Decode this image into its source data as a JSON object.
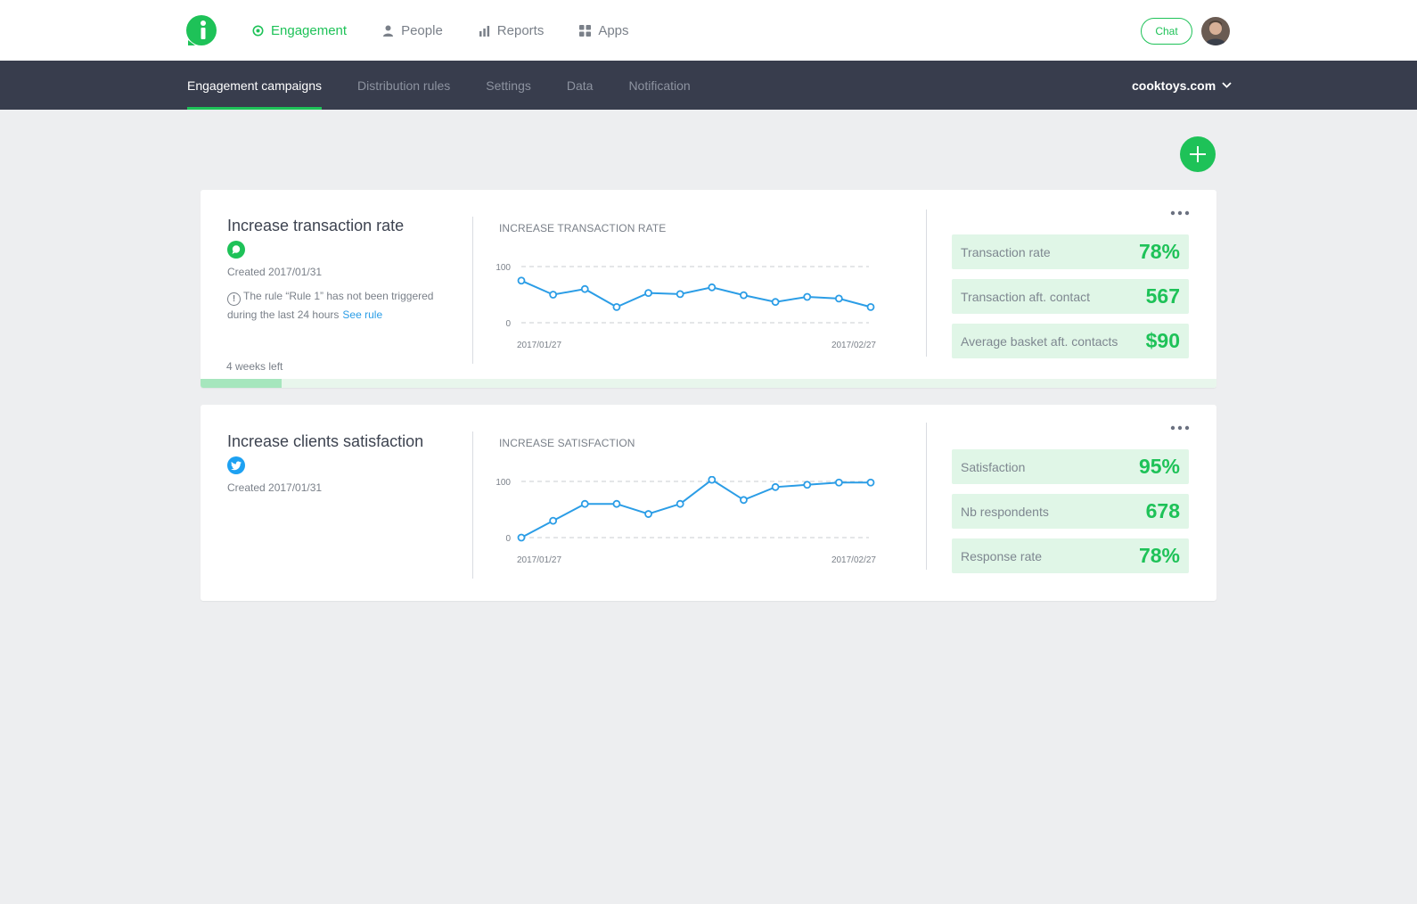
{
  "nav": {
    "items": [
      {
        "label": "Engagement",
        "icon": "target-icon",
        "active": true
      },
      {
        "label": "People",
        "icon": "person-icon",
        "active": false
      },
      {
        "label": "Reports",
        "icon": "bar-chart-icon",
        "active": false
      },
      {
        "label": "Apps",
        "icon": "grid-icon",
        "active": false
      }
    ],
    "chat_label": "Chat"
  },
  "subnav": {
    "tabs": [
      {
        "label": "Engagement campaigns",
        "active": true
      },
      {
        "label": "Distribution rules",
        "active": false
      },
      {
        "label": "Settings",
        "active": false
      },
      {
        "label": "Data",
        "active": false
      },
      {
        "label": "Notification",
        "active": false
      }
    ],
    "site": "cooktoys.com"
  },
  "colors": {
    "accent": "#1ec258",
    "chart_line": "#2b9de6",
    "twitter": "#1da1f2",
    "subnav_bg": "#383d4d"
  },
  "campaigns": [
    {
      "title": "Increase transaction rate",
      "channel_icon": "chat-bubble-icon",
      "created": "Created 2017/01/31",
      "warning_text": "The rule “Rule 1” has not been triggered during the last 24 hours",
      "warning_link": "See rule",
      "weeks_left": "4 weeks left",
      "progress": 0.08,
      "chart_title": "INCREASE TRANSACTION RATE",
      "stats": [
        {
          "label": "Transaction rate",
          "value": "78%"
        },
        {
          "label": "Transaction aft. contact",
          "value": "567"
        },
        {
          "label": "Average basket aft. contacts",
          "value": "$90"
        }
      ]
    },
    {
      "title": "Increase clients satisfaction",
      "channel_icon": "twitter-icon",
      "created": "Created 2017/01/31",
      "chart_title": "INCREASE SATISFACTION",
      "stats": [
        {
          "label": "Satisfaction",
          "value": "95%"
        },
        {
          "label": "Nb respondents",
          "value": "678"
        },
        {
          "label": "Response rate",
          "value": "78%"
        }
      ]
    }
  ],
  "chart_data": [
    {
      "type": "line",
      "title": "INCREASE TRANSACTION RATE",
      "x": [
        "2017/01/27",
        "",
        "",
        "",
        "",
        "",
        "",
        "",
        "",
        "",
        "",
        "2017/02/27"
      ],
      "x_tick_labels": [
        "2017/01/27",
        "2017/02/27"
      ],
      "y_tick_labels": [
        "100",
        "0"
      ],
      "ylim": [
        0,
        100
      ],
      "grid": true,
      "series": [
        {
          "values": [
            75,
            50,
            60,
            28,
            53,
            51,
            63,
            49,
            37,
            46,
            43,
            28
          ]
        }
      ]
    },
    {
      "type": "line",
      "title": "INCREASE SATISFACTION",
      "x": [
        "2017/01/27",
        "",
        "",
        "",
        "",
        "",
        "",
        "",
        "",
        "",
        "",
        "2017/02/27"
      ],
      "x_tick_labels": [
        "2017/01/27",
        "2017/02/27"
      ],
      "y_tick_labels": [
        "100",
        "0"
      ],
      "ylim": [
        0,
        100
      ],
      "grid": true,
      "series": [
        {
          "values": [
            0,
            30,
            60,
            60,
            42,
            60,
            103,
            67,
            90,
            94,
            98,
            98
          ]
        }
      ]
    }
  ]
}
